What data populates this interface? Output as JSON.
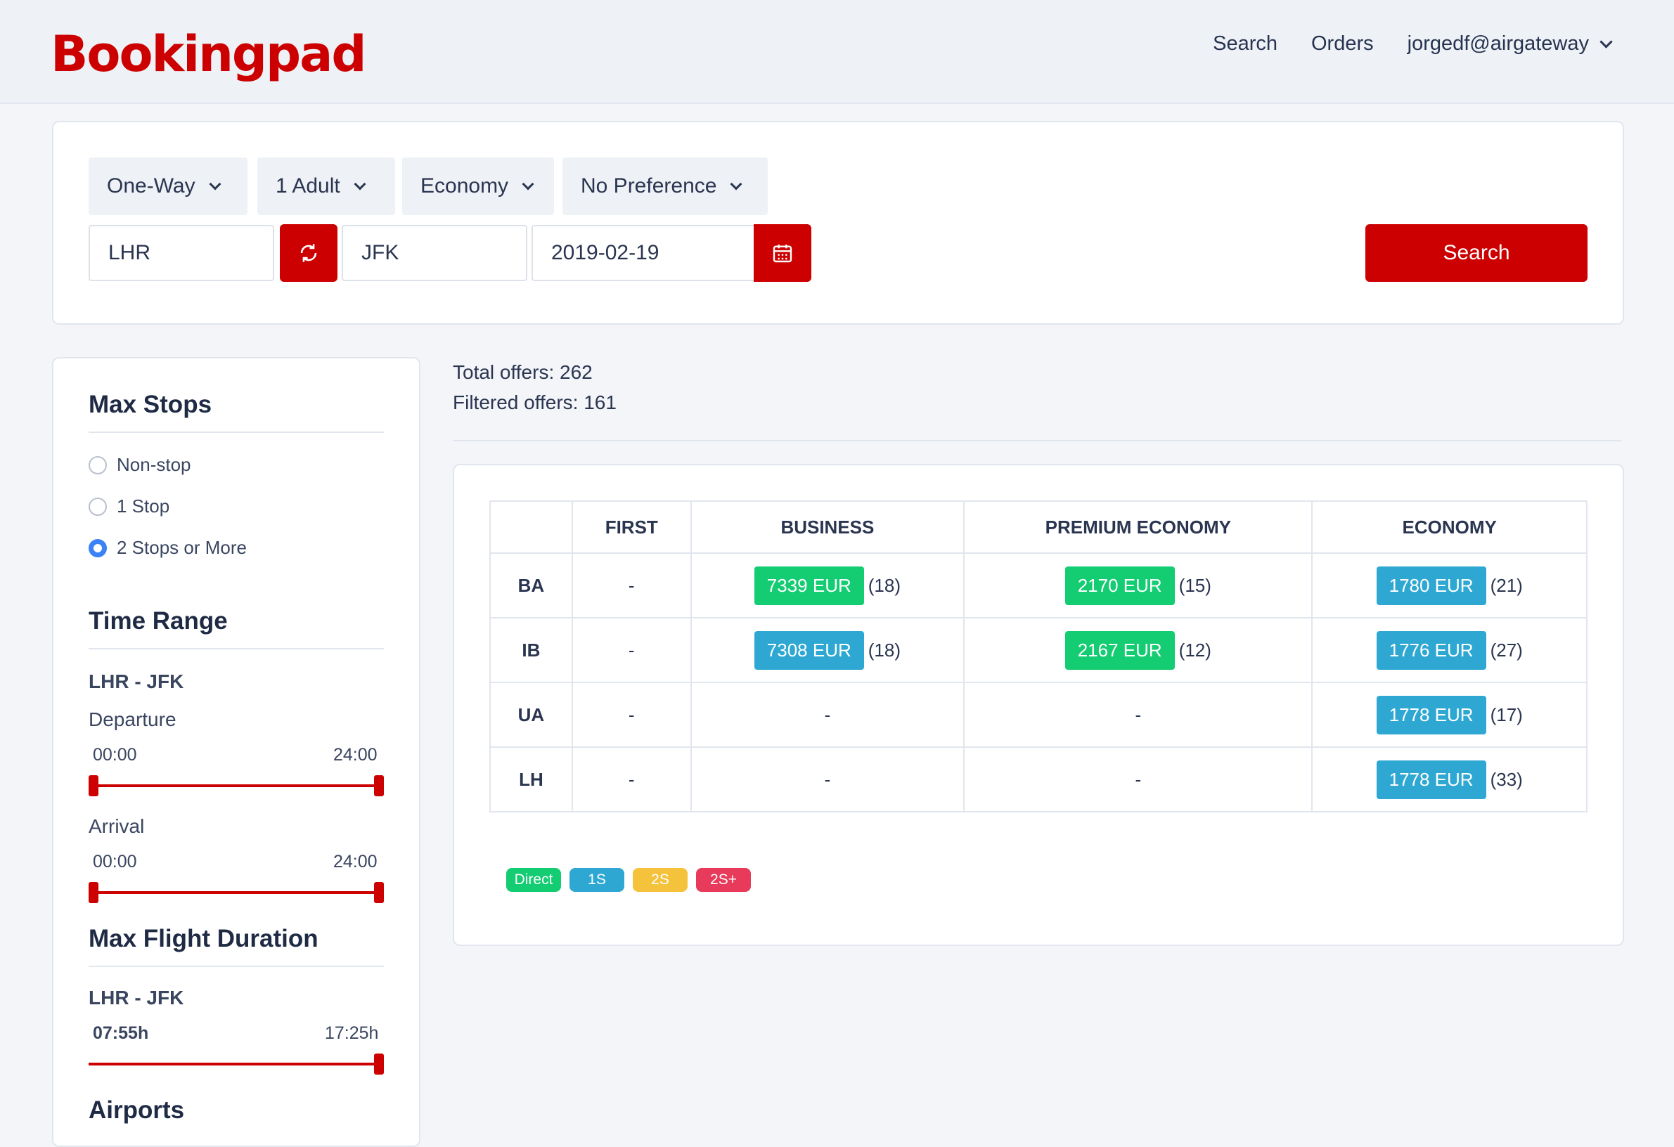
{
  "header": {
    "logo": "Bookingpad",
    "nav": {
      "search": "Search",
      "orders": "Orders",
      "user": "jorgedf@airgateway"
    }
  },
  "search": {
    "trip_type": "One-Way",
    "passengers": "1 Adult",
    "cabin": "Economy",
    "preference": "No Preference",
    "origin": "LHR",
    "destination": "JFK",
    "date": "2019-02-19",
    "search_label": "Search",
    "swap_icon": "swap-icon",
    "calendar_icon": "calendar-icon"
  },
  "sidebar": {
    "max_stops": {
      "title": "Max Stops",
      "options": [
        "Non-stop",
        "1 Stop",
        "2 Stops or More"
      ],
      "selected": "2 Stops or More"
    },
    "time_range": {
      "title": "Time Range",
      "route": "LHR - JFK",
      "departure": {
        "label": "Departure",
        "min": "00:00",
        "max": "24:00"
      },
      "arrival": {
        "label": "Arrival",
        "min": "00:00",
        "max": "24:00"
      }
    },
    "max_flight_duration": {
      "title": "Max Flight Duration",
      "route": "LHR - JFK",
      "min": "07:55h",
      "max": "17:25h"
    },
    "airports": {
      "title": "Airports"
    }
  },
  "stats": {
    "total": "Total offers: 262",
    "filtered": "Filtered offers: 161"
  },
  "results": {
    "columns": [
      "",
      "FIRST",
      "BUSINESS",
      "PREMIUM ECONOMY",
      "ECONOMY"
    ],
    "rows": [
      {
        "airline": "BA",
        "first": "-",
        "business": {
          "price": "7339 EUR",
          "count": "(18)",
          "type": "direct"
        },
        "premium": {
          "price": "2170 EUR",
          "count": "(15)",
          "type": "direct"
        },
        "economy": {
          "price": "1780 EUR",
          "count": "(21)",
          "type": "1s"
        }
      },
      {
        "airline": "IB",
        "first": "-",
        "business": {
          "price": "7308 EUR",
          "count": "(18)",
          "type": "1s"
        },
        "premium": {
          "price": "2167 EUR",
          "count": "(12)",
          "type": "direct"
        },
        "economy": {
          "price": "1776 EUR",
          "count": "(27)",
          "type": "1s"
        }
      },
      {
        "airline": "UA",
        "first": "-",
        "business": "-",
        "premium": "-",
        "economy": {
          "price": "1778 EUR",
          "count": "(17)",
          "type": "1s"
        }
      },
      {
        "airline": "LH",
        "first": "-",
        "business": "-",
        "premium": "-",
        "economy": {
          "price": "1778 EUR",
          "count": "(33)",
          "type": "1s"
        }
      }
    ],
    "legend": [
      {
        "label": "Direct",
        "color": "#14cc72"
      },
      {
        "label": "1S",
        "color": "#2ea8d3"
      },
      {
        "label": "2S",
        "color": "#f5c23c"
      },
      {
        "label": "2S+",
        "color": "#e83a5a"
      }
    ]
  },
  "colors": {
    "brand": "#cc0000",
    "direct": "#14cc72",
    "one_stop": "#2ea8d3",
    "radio_selected": "#3b82f6"
  }
}
